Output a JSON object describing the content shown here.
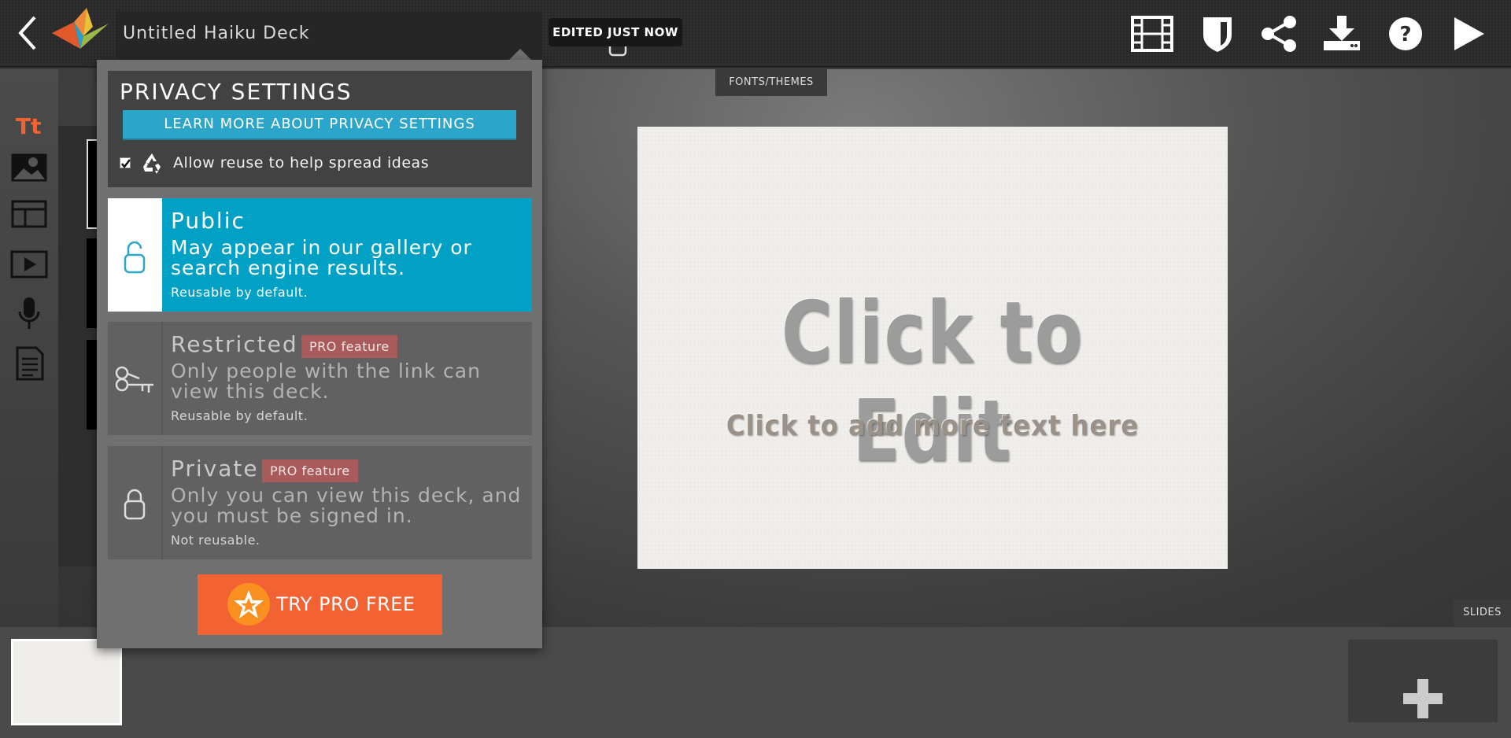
{
  "header": {
    "deck_title": "Untitled Haiku Deck",
    "edited_status": "EDITED JUST NOW",
    "icons": [
      "back-icon",
      "haiku-deck-logo",
      "unlock-icon",
      "caret-down-icon",
      "film-icon",
      "shield-icon",
      "share-icon",
      "download-icon",
      "help-icon",
      "play-icon"
    ]
  },
  "left_toolbar": {
    "icons": [
      "text-icon",
      "image-icon",
      "layout-icon",
      "video-icon",
      "microphone-icon",
      "notes-icon"
    ],
    "active_color": "#f26233"
  },
  "canvas": {
    "fonts_tab": "FONTS/THEMES",
    "slide_title": "Click to Edit",
    "slide_subtitle": "Click to add more text here",
    "slides_tab": "SLIDES"
  },
  "privacy": {
    "title": "PRIVACY SETTINGS",
    "learn_more": "LEARN MORE ABOUT PRIVACY SETTINGS",
    "allow_reuse_label": "Allow reuse to help spread ideas",
    "allow_reuse_checked": true,
    "options": [
      {
        "name": "Public",
        "description": "May appear in our gallery or search engine results.",
        "note": "Reusable by default.",
        "selected": true,
        "icon": "unlock-icon"
      },
      {
        "name": "Restricted",
        "badge": "PRO feature",
        "description": "Only people with the link can view this deck.",
        "note": "Reusable by default.",
        "selected": false,
        "icon": "key-icon"
      },
      {
        "name": "Private",
        "badge": "PRO feature",
        "description": "Only you can view this deck, and you must be signed in.",
        "note": "Not reusable.",
        "selected": false,
        "icon": "lock-icon"
      }
    ],
    "try_pro": "TRY PRO FREE"
  },
  "colors": {
    "accent_blue": "#01a1c5",
    "learn_btn": "#2ba5c9",
    "pro_orange": "#f26233",
    "badge_red": "#a95a5a"
  }
}
